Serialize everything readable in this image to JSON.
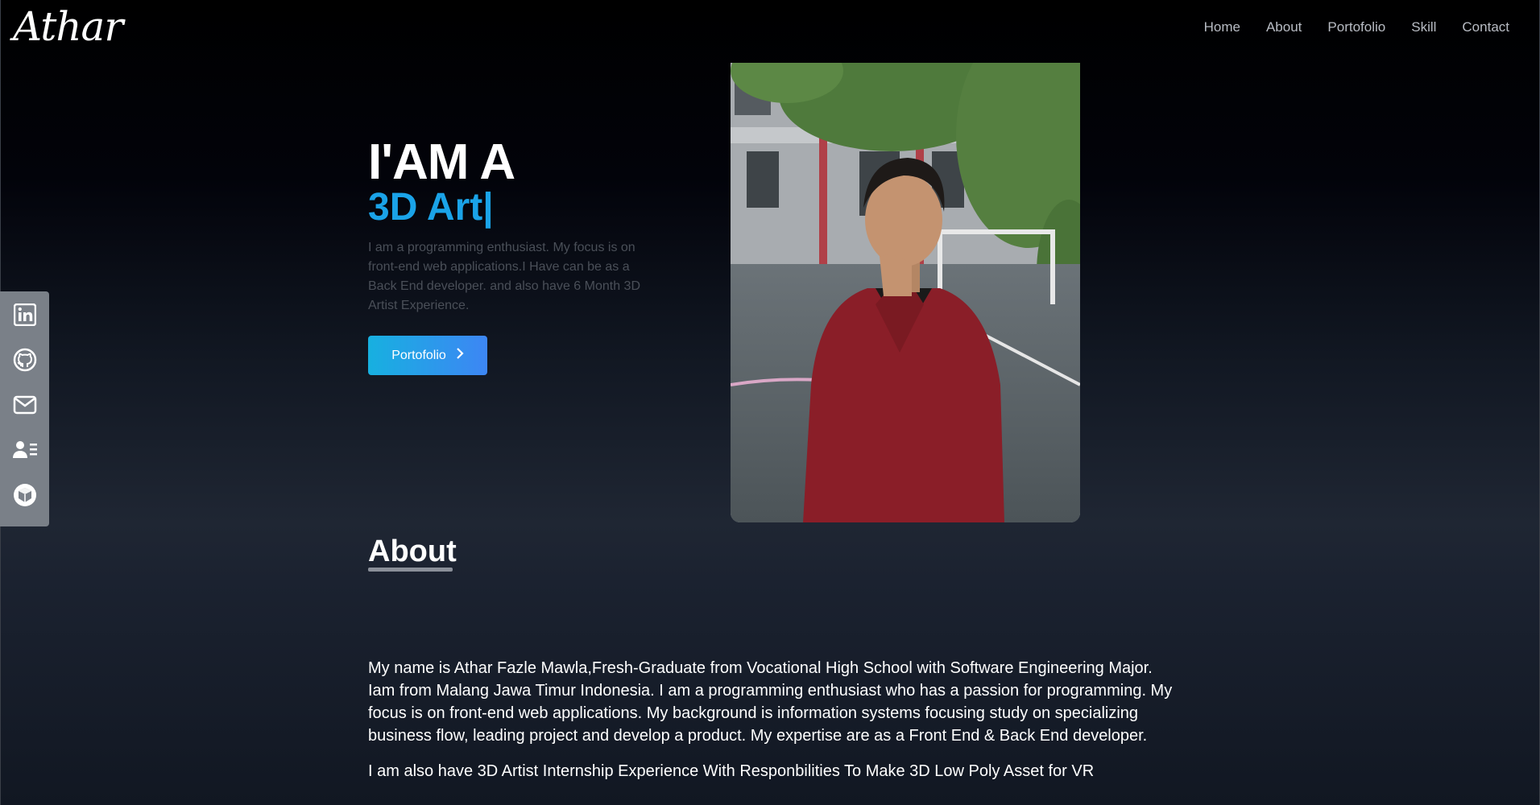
{
  "header": {
    "logo": "Athar",
    "nav": [
      "Home",
      "About",
      "Portofolio",
      "Skill",
      "Contact"
    ]
  },
  "social": [
    {
      "name": "linkedin-icon"
    },
    {
      "name": "github-icon"
    },
    {
      "name": "mail-icon"
    },
    {
      "name": "contact-card-icon"
    },
    {
      "name": "3d-box-icon"
    }
  ],
  "hero": {
    "title": "I'AM A",
    "subtitle": "3D Art|",
    "description": "I am a programming enthusiast. My focus is on front-end web applications.I Have can be as a Back End developer. and also have 6 Month 3D Artist Experience.",
    "button_label": "Portofolio",
    "accent": "#1aa3e8"
  },
  "about": {
    "title": "About",
    "paragraphs": [
      "My name is Athar Fazle Mawla,Fresh-Graduate from Vocational High School with Software Engineering Major. Iam from Malang Jawa Timur Indonesia. I am a programming enthusiast who has a passion for programming. My focus is on front-end web applications. My background is information systems focusing study on specializing business flow, leading project and develop a product. My expertise are as a Front End & Back End developer.",
      "I am also have 3D Artist Internship Experience With Responbilities To Make 3D Low Poly Asset for VR"
    ]
  }
}
